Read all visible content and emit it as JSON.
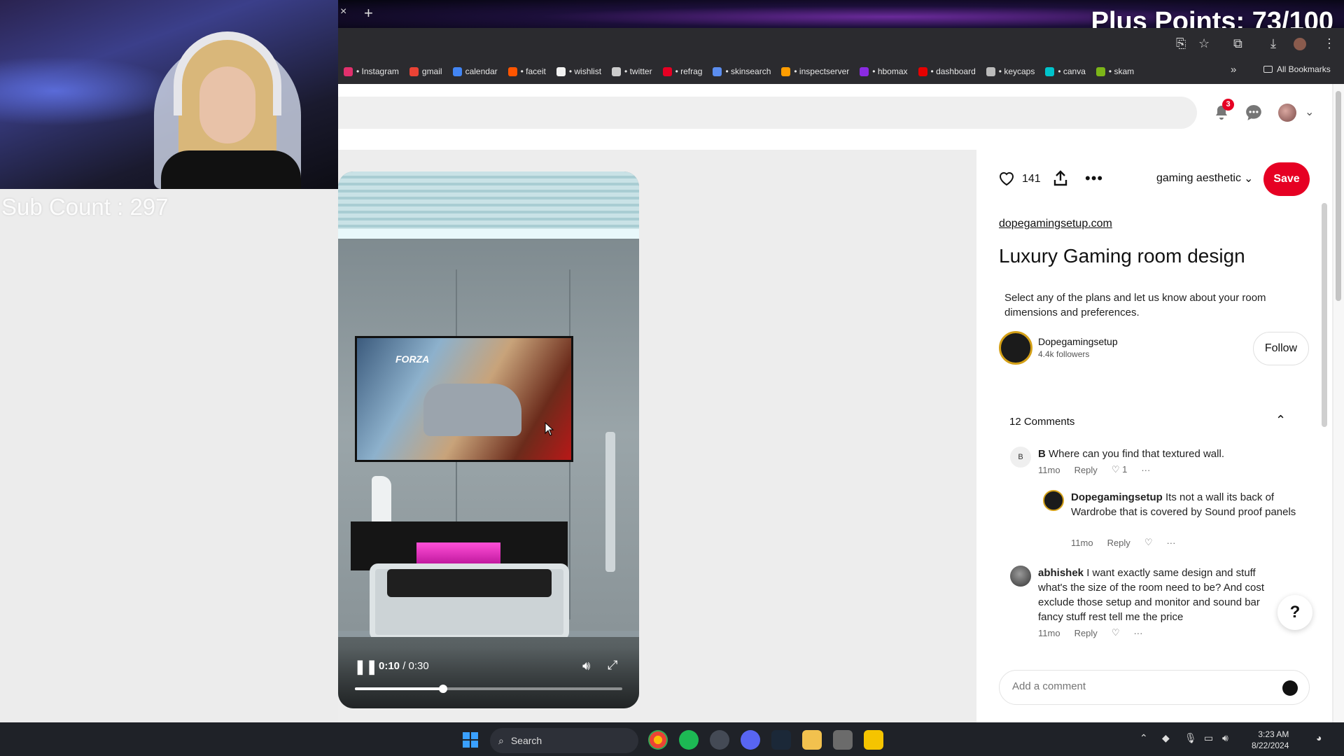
{
  "overlay": {
    "sub_count": "Sub Count : 297",
    "plus_points": "Plus Points: 73/100"
  },
  "browser": {
    "tab_close": "×",
    "tab_new": "+",
    "bookmarks": [
      {
        "label": "• Instagram",
        "color": "#e1306c"
      },
      {
        "label": "gmail",
        "color": "#ea4335"
      },
      {
        "label": "calendar",
        "color": "#4285f4"
      },
      {
        "label": "• faceit",
        "color": "#ff5500"
      },
      {
        "label": "• wishlist",
        "color": "#f2f2f2"
      },
      {
        "label": "• twitter",
        "color": "#cccccc"
      },
      {
        "label": "• refrag",
        "color": "#e60023"
      },
      {
        "label": "• skinsearch",
        "color": "#5b8def"
      },
      {
        "label": "• inspectserver",
        "color": "#ff9d00"
      },
      {
        "label": "• hbomax",
        "color": "#8a2be2"
      },
      {
        "label": "• dashboard",
        "color": "#e60000"
      },
      {
        "label": "• keycaps",
        "color": "#bbbbbb"
      },
      {
        "label": "• canva",
        "color": "#00c4cc"
      },
      {
        "label": "• skam",
        "color": "#7cb518"
      }
    ],
    "bookmarks_more": "»",
    "all_bookmarks": "All Bookmarks"
  },
  "header": {
    "notification_count": "3"
  },
  "video": {
    "tv_title": "FORZA",
    "time_current": "0:10",
    "time_total": "/ 0:30",
    "progress": 0.33
  },
  "pin": {
    "like_count": "141",
    "board": "gaming aesthetic",
    "save_label": "Save",
    "source": "dopegamingsetup.com",
    "title": "Luxury Gaming room design",
    "description": "Select any of the plans and let us know about your room dimensions and preferences.",
    "creator": {
      "name": "Dopegamingsetup",
      "followers": "4.4k followers",
      "follow_label": "Follow"
    },
    "comments_header": "12 Comments",
    "comments": [
      {
        "avatar_letter": "B",
        "author": "B",
        "text": "Where can you find that textured wall.",
        "age": "11mo",
        "reply": "Reply",
        "likes": "1",
        "more": "···"
      },
      {
        "author": "Dopegamingsetup",
        "text": "Its not a wall its back of Wardrobe that is covered by Sound proof panels",
        "age": "11mo",
        "reply": "Reply",
        "more": "···"
      },
      {
        "author": "abhishek",
        "text": "I want exactly same design and stuff what's the size of the room need to be? And cost exclude those setup and monitor and sound bar fancy stuff rest tell me the price",
        "age": "11mo",
        "reply": "Reply",
        "more": "···"
      }
    ],
    "add_comment_placeholder": "Add a comment",
    "help": "?"
  },
  "taskbar": {
    "search_label": "Search",
    "time": "3:23 AM",
    "date": "8/22/2024"
  }
}
